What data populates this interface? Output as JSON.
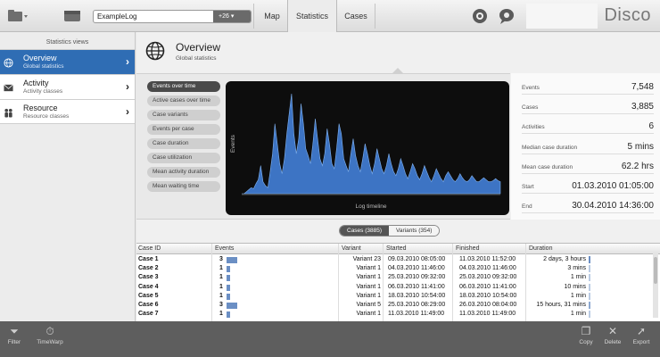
{
  "toolbar": {
    "log_name": "ExampleLog",
    "log_count": "+26 ▾",
    "tabs": [
      {
        "label": "Map",
        "active": false
      },
      {
        "label": "Statistics",
        "active": true
      },
      {
        "label": "Cases",
        "active": false
      }
    ],
    "brand": "Disco"
  },
  "sidebar": {
    "header": "Statistics views",
    "items": [
      {
        "title": "Overview",
        "subtitle": "Global statistics",
        "selected": true,
        "icon": "globe-icon"
      },
      {
        "title": "Activity",
        "subtitle": "Activity classes",
        "selected": false,
        "icon": "envelope-icon"
      },
      {
        "title": "Resource",
        "subtitle": "Resource classes",
        "selected": false,
        "icon": "people-icon"
      }
    ]
  },
  "overview": {
    "title": "Overview",
    "subtitle": "Global statistics"
  },
  "chart_menu": [
    "Events over time",
    "Active cases over time",
    "Case variants",
    "Events per case",
    "Case duration",
    "Case utilization",
    "Mean activity duration",
    "Mean waiting time"
  ],
  "chart_data": {
    "type": "area",
    "xlabel": "Log timeline",
    "ylabel": "Events",
    "values": [
      0,
      0,
      2,
      4,
      6,
      5,
      10,
      14,
      28,
      12,
      8,
      6,
      22,
      40,
      70,
      50,
      30,
      20,
      35,
      60,
      80,
      100,
      60,
      40,
      55,
      90,
      70,
      45,
      38,
      30,
      50,
      75,
      55,
      35,
      28,
      40,
      65,
      50,
      30,
      25,
      45,
      70,
      60,
      35,
      28,
      22,
      40,
      55,
      38,
      28,
      22,
      35,
      50,
      40,
      28,
      20,
      30,
      45,
      35,
      25,
      20,
      28,
      40,
      30,
      22,
      18,
      25,
      35,
      28,
      20,
      15,
      22,
      30,
      25,
      18,
      14,
      20,
      28,
      22,
      16,
      12,
      18,
      25,
      20,
      15,
      12,
      18,
      22,
      18,
      14,
      12,
      15,
      20,
      16,
      13,
      12,
      14,
      18,
      15,
      12,
      12,
      14,
      16,
      14,
      12,
      12,
      13,
      15,
      13,
      12
    ]
  },
  "stats": [
    {
      "label": "Events",
      "value": "7,548"
    },
    {
      "label": "Cases",
      "value": "3,885"
    },
    {
      "label": "Activities",
      "value": "6"
    },
    {
      "label": "Median case duration",
      "value": "5 mins"
    },
    {
      "label": "Mean case duration",
      "value": "62.2 hrs"
    },
    {
      "label": "Start",
      "value": "01.03.2010 01:05:00"
    },
    {
      "label": "End",
      "value": "30.04.2010 14:36:00"
    }
  ],
  "table_tabs": [
    {
      "label": "Cases (3885)",
      "active": true
    },
    {
      "label": "Variants (354)",
      "active": false
    }
  ],
  "table": {
    "headers": [
      "Case ID",
      "Events",
      "Variant",
      "Started",
      "Finished",
      "Duration"
    ],
    "rows": [
      {
        "case_id": "Case 1",
        "events": "3",
        "events_n": 3,
        "variant": "Variant 23",
        "started": "09.03.2010 08:05:00",
        "finished": "11.03.2010 11:52:00",
        "duration": "2 days, 3 hours",
        "dur_n": 1.0
      },
      {
        "case_id": "Case 2",
        "events": "1",
        "events_n": 1,
        "variant": "Variant 1",
        "started": "04.03.2010 11:46:00",
        "finished": "04.03.2010 11:46:00",
        "duration": "3 mins",
        "dur_n": 0.1
      },
      {
        "case_id": "Case 3",
        "events": "1",
        "events_n": 1,
        "variant": "Variant 1",
        "started": "25.03.2010 09:32:00",
        "finished": "25.03.2010 09:32:00",
        "duration": "1 min",
        "dur_n": 0.1
      },
      {
        "case_id": "Case 4",
        "events": "1",
        "events_n": 1,
        "variant": "Variant 1",
        "started": "06.03.2010 11:41:00",
        "finished": "06.03.2010 11:41:00",
        "duration": "10 mins",
        "dur_n": 0.1
      },
      {
        "case_id": "Case 5",
        "events": "1",
        "events_n": 1,
        "variant": "Variant 1",
        "started": "18.03.2010 10:54:00",
        "finished": "18.03.2010 10:54:00",
        "duration": "1 min",
        "dur_n": 0.1
      },
      {
        "case_id": "Case 6",
        "events": "3",
        "events_n": 3,
        "variant": "Variant 5",
        "started": "25.03.2010 08:29:00",
        "finished": "26.03.2010 08:04:00",
        "duration": "15 hours, 31 mins",
        "dur_n": 0.6
      },
      {
        "case_id": "Case 7",
        "events": "1",
        "events_n": 1,
        "variant": "Variant 1",
        "started": "11.03.2010 11:49:00",
        "finished": "11.03.2010 11:49:00",
        "duration": "1 min",
        "dur_n": 0.1
      }
    ]
  },
  "bottom_bar": {
    "left": [
      {
        "label": "Filter",
        "icon": "funnel-icon"
      },
      {
        "label": "TimeWarp",
        "icon": "timewarp-icon"
      }
    ],
    "right": [
      {
        "label": "Copy",
        "icon": "copy-icon"
      },
      {
        "label": "Delete",
        "icon": "delete-icon"
      },
      {
        "label": "Export",
        "icon": "export-icon"
      }
    ]
  }
}
